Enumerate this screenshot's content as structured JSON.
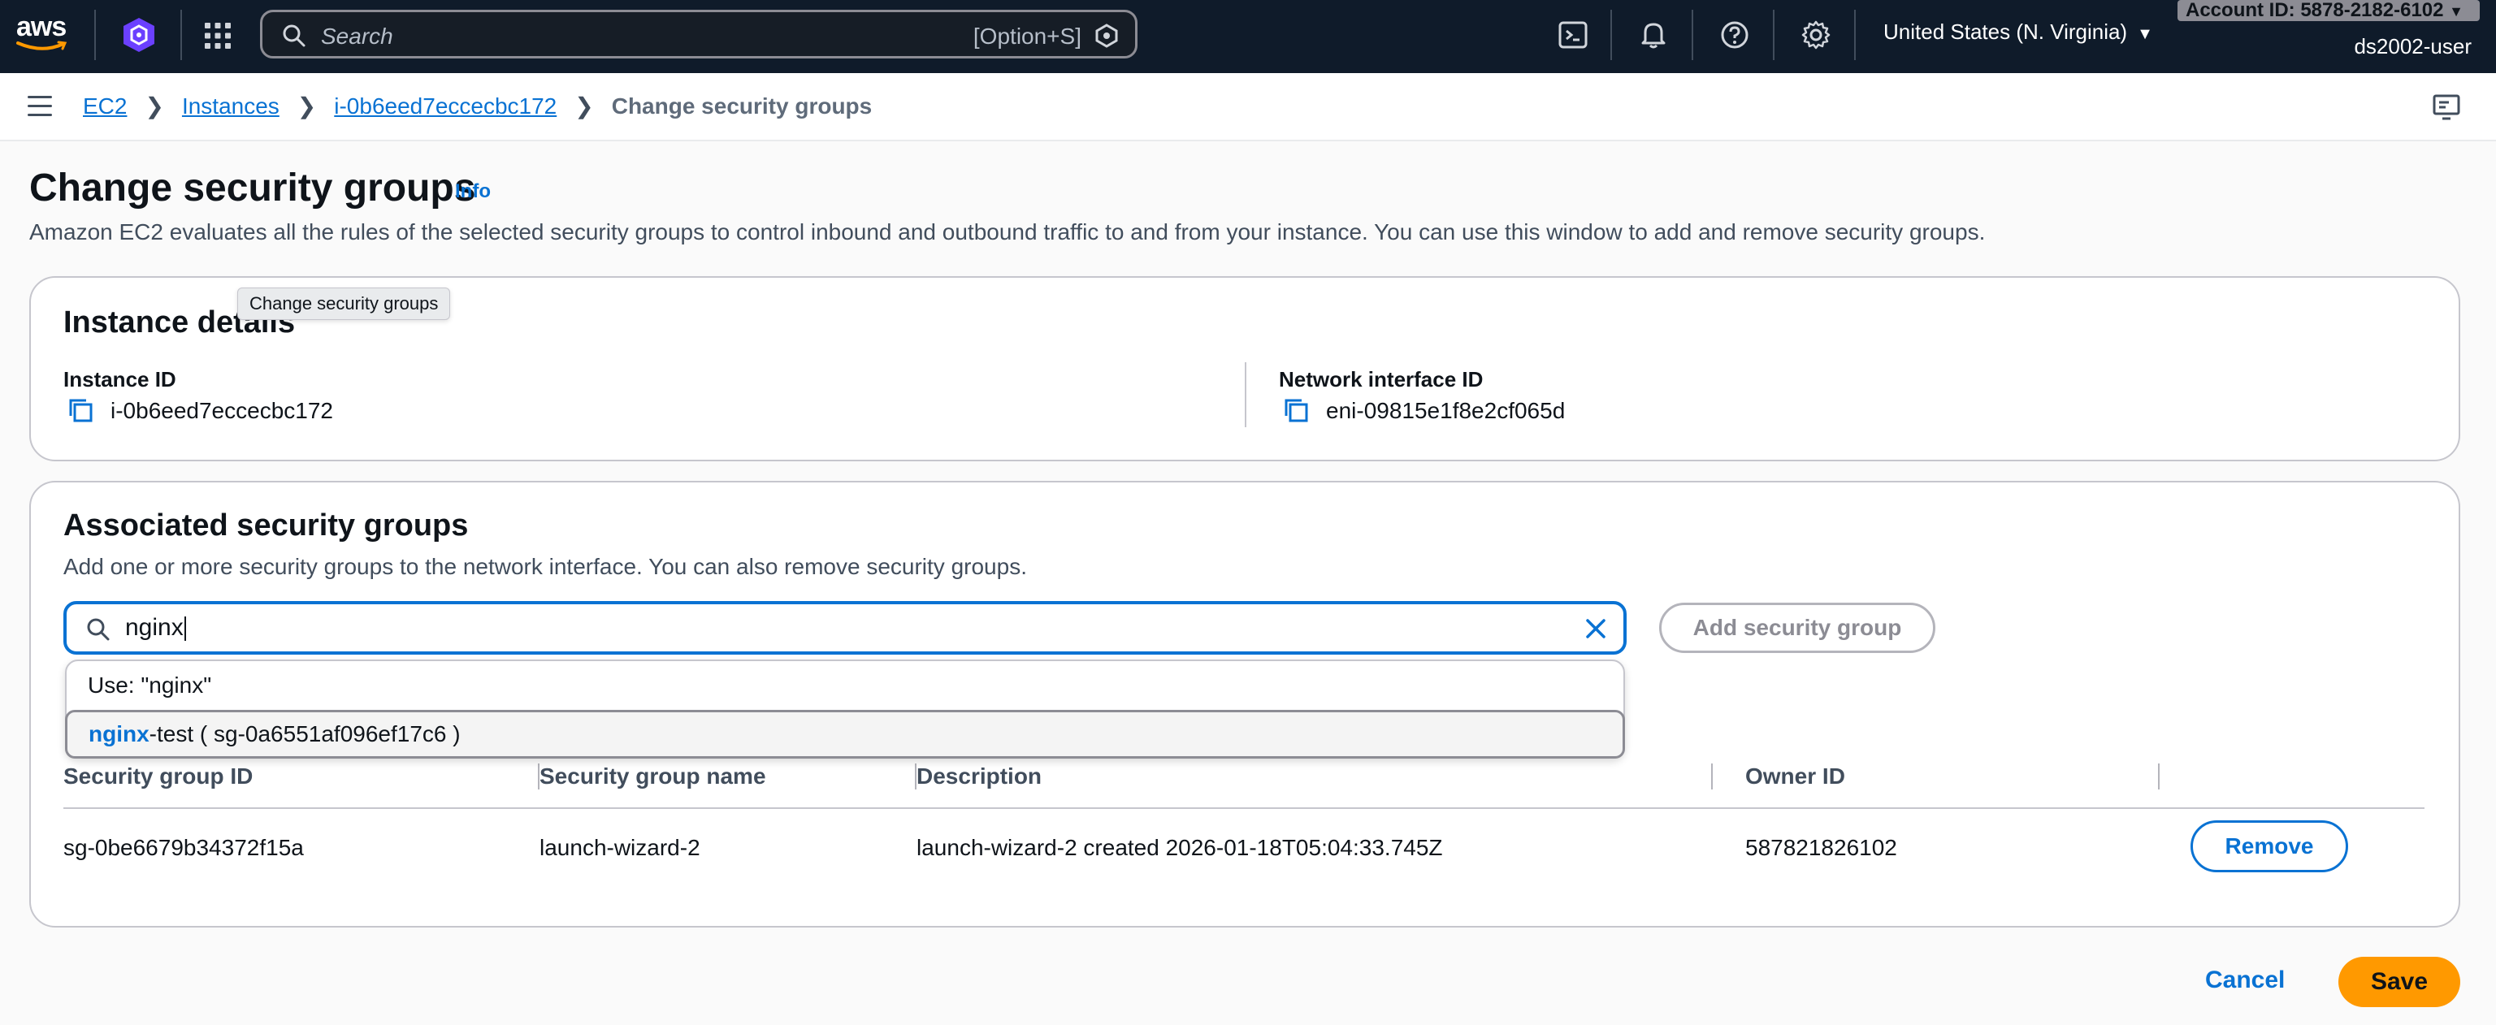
{
  "topnav": {
    "logo_text": "aws",
    "search_placeholder": "Search",
    "search_shortcut": "[Option+S]",
    "region": "United States (N. Virginia)",
    "account": "Account ID: 5878-2182-6102",
    "user": "ds2002-user"
  },
  "breadcrumb": {
    "items": [
      "EC2",
      "Instances",
      "i-0b6eed7eccecbc172"
    ],
    "current": "Change security groups"
  },
  "page": {
    "title": "Change security groups",
    "info": "Info",
    "description": "Amazon EC2 evaluates all the rules of the selected security groups to control inbound and outbound traffic to and from your instance. You can use this window to add and remove security groups.",
    "tooltip": "Change security groups"
  },
  "instance_details": {
    "heading": "Instance details",
    "instance_id_label": "Instance ID",
    "instance_id": "i-0b6eed7eccecbc172",
    "eni_label": "Network interface ID",
    "eni_id": "eni-09815e1f8e2cf065d"
  },
  "security_groups": {
    "heading": "Associated security groups",
    "description": "Add one or more security groups to the network interface. You can also remove security groups.",
    "search_value": "nginx",
    "add_button": "Add security group",
    "dropdown": {
      "use_option": "Use: \"nginx\"",
      "match_highlight": "nginx",
      "match_rest": "-test ( sg-0a6551af096ef17c6 )"
    },
    "columns": [
      "Security group ID",
      "Security group name",
      "Description",
      "Owner ID"
    ],
    "rows": [
      {
        "id": "sg-0be6679b34372f15a",
        "name": "launch-wizard-2",
        "description": "launch-wizard-2 created 2026-01-18T05:04:33.745Z",
        "owner": "587821826102",
        "action": "Remove"
      }
    ]
  },
  "footer": {
    "cancel": "Cancel",
    "save": "Save"
  },
  "colors": {
    "nav_bg": "#0f1b2a",
    "link": "#0972d3",
    "primary": "#ff9900"
  }
}
